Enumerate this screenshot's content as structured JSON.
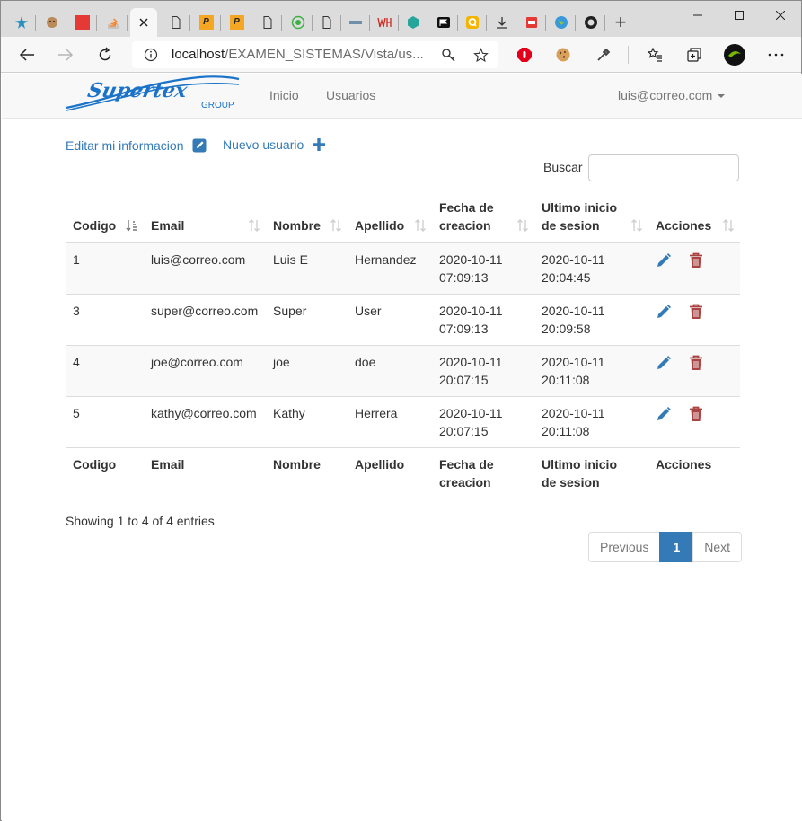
{
  "browser": {
    "url_host": "localhost",
    "url_path": "/EXAMEN_SISTEMAS/Vista/us...",
    "new_tab_label": "+"
  },
  "navbar": {
    "brand_name": "Supertex",
    "brand_sub": "GROUP",
    "links": [
      "Inicio",
      "Usuarios"
    ],
    "user_email": "luis@correo.com"
  },
  "actions": {
    "edit_info_label": "Editar mi informacion",
    "new_user_label": "Nuevo usuario"
  },
  "search": {
    "label": "Buscar",
    "value": ""
  },
  "table": {
    "headers": [
      "Codigo",
      "Email",
      "Nombre",
      "Apellido",
      "Fecha de creacion",
      "Ultimo inicio de sesion",
      "Acciones"
    ],
    "rows": [
      [
        "1",
        "luis@correo.com",
        "Luis E",
        "Hernandez",
        "2020-10-11 07:09:13",
        "2020-10-11 20:04:45"
      ],
      [
        "3",
        "super@correo.com",
        "Super",
        "User",
        "2020-10-11 07:09:13",
        "2020-10-11 20:09:58"
      ],
      [
        "4",
        "joe@correo.com",
        "joe",
        "doe",
        "2020-10-11 20:07:15",
        "2020-10-11 20:11:08"
      ],
      [
        "5",
        "kathy@correo.com",
        "Kathy",
        "Herrera",
        "2020-10-11 20:07:15",
        "2020-10-11 20:11:08"
      ]
    ]
  },
  "info_text": "Showing 1 to 4 of 4 entries",
  "pagination": {
    "previous": "Previous",
    "current": "1",
    "next": "Next"
  },
  "colors": {
    "link": "#337ab7",
    "edit_icon": "#337ab7",
    "delete_icon": "#a94442",
    "brand": "#1a73c8"
  }
}
